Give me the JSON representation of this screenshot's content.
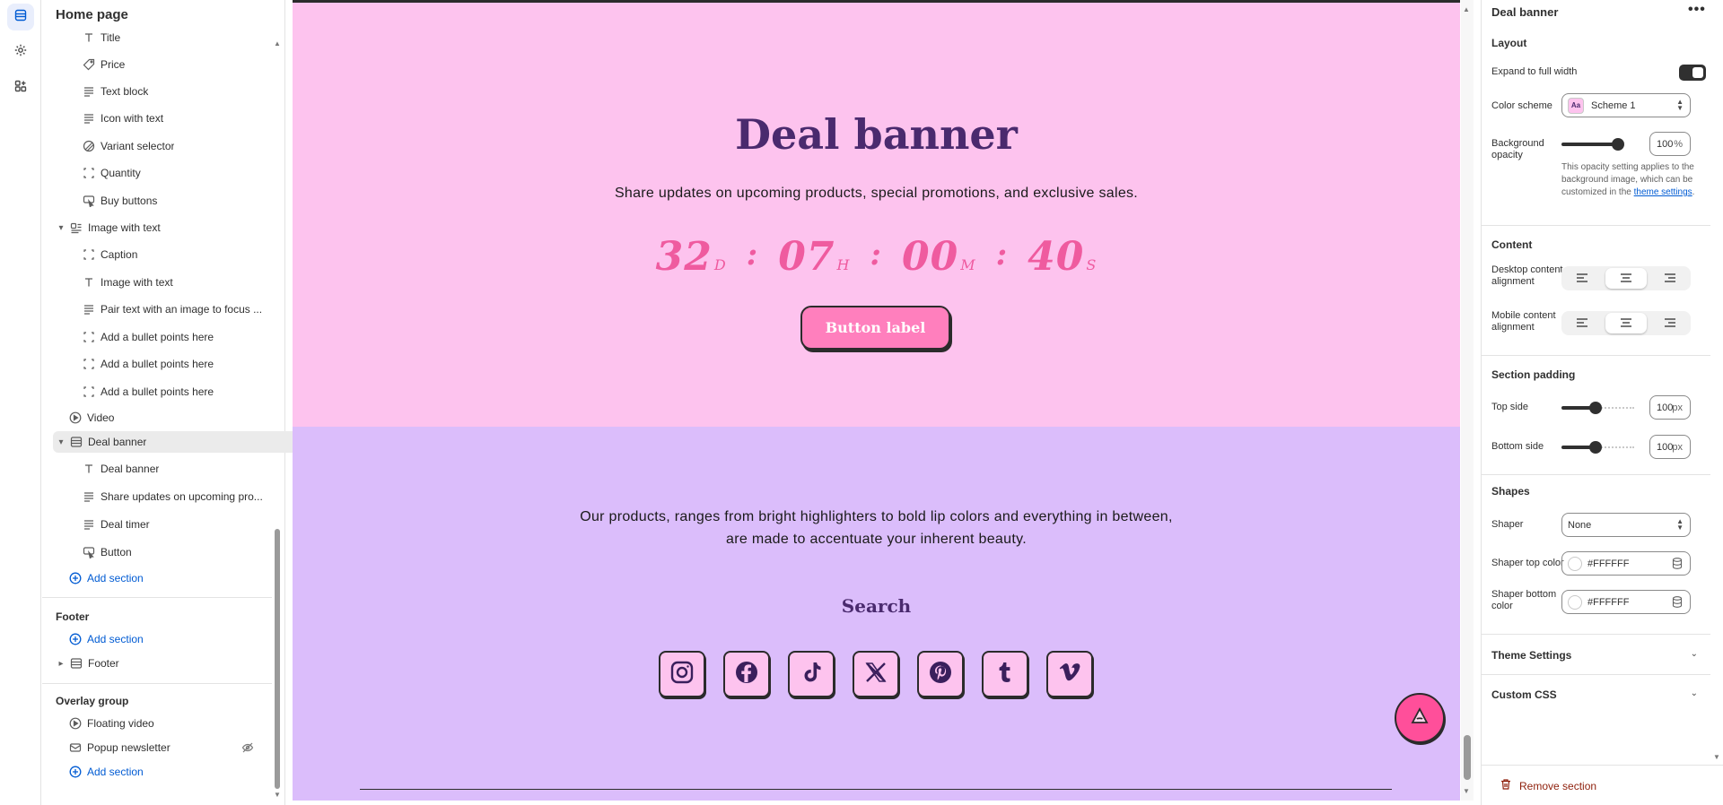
{
  "sidebar": {
    "title": "Home page",
    "items": [
      {
        "label": "Title",
        "icon": "text-icon"
      },
      {
        "label": "Price",
        "icon": "price-tag-icon"
      },
      {
        "label": "Text block",
        "icon": "text-lines-icon"
      },
      {
        "label": "Icon with text",
        "icon": "text-lines-icon"
      },
      {
        "label": "Variant selector",
        "icon": "variant-icon"
      },
      {
        "label": "Quantity",
        "icon": "block-icon"
      },
      {
        "label": "Buy buttons",
        "icon": "cursor-button-icon"
      },
      {
        "label": "Image with text",
        "icon": "image-text-icon"
      },
      {
        "label": "Caption",
        "icon": "block-icon"
      },
      {
        "label": "Image with text",
        "icon": "text-icon"
      },
      {
        "label": "Pair text with an image to focus ...",
        "icon": "text-lines-icon"
      },
      {
        "label": "Add a bullet points here",
        "icon": "block-icon"
      },
      {
        "label": "Add a bullet points here",
        "icon": "block-icon"
      },
      {
        "label": "Add a bullet points here",
        "icon": "block-icon"
      },
      {
        "label": "Video",
        "icon": "play-icon"
      },
      {
        "label": "Deal banner",
        "icon": "section-icon"
      },
      {
        "label": "Deal banner",
        "icon": "text-icon"
      },
      {
        "label": "Share updates on upcoming pro...",
        "icon": "text-lines-icon"
      },
      {
        "label": "Deal timer",
        "icon": "text-lines-icon"
      },
      {
        "label": "Button",
        "icon": "cursor-button-icon"
      }
    ],
    "add_section": "Add section",
    "footer_group": {
      "title": "Footer",
      "add_section": "Add section",
      "item": "Footer"
    },
    "overlay_group": {
      "title": "Overlay group",
      "items": [
        "Floating video",
        "Popup newsletter"
      ],
      "add_section": "Add section"
    }
  },
  "preview": {
    "deal": {
      "title": "Deal banner",
      "subtitle": "Share updates on upcoming products, special promotions, and exclusive sales.",
      "timer": [
        {
          "value": "32",
          "unit": "D"
        },
        {
          "value": "07",
          "unit": "H"
        },
        {
          "value": "00",
          "unit": "M"
        },
        {
          "value": "40",
          "unit": "S"
        }
      ],
      "separator": ":",
      "button": "Button label",
      "colors": {
        "background": "#fdc3ee",
        "title": "#4a2a6e",
        "timer": "#ef5b9f",
        "button": "#ff7fbd"
      }
    },
    "lower": {
      "text": "Our products, ranges from bright highlighters to bold lip colors and everything in between, are made to accentuate your inherent beauty.",
      "search_title": "Search",
      "social_icons": [
        "instagram-icon",
        "facebook-icon",
        "tiktok-icon",
        "x-icon",
        "pinterest-icon",
        "tumblr-icon",
        "vimeo-icon"
      ],
      "background": "#dbbdfb"
    }
  },
  "panel": {
    "title": "Deal banner",
    "more": "•••",
    "layout": {
      "heading": "Layout",
      "expand_label": "Expand to full width",
      "expand_on": true,
      "color_scheme_label": "Color scheme",
      "color_scheme_value": "Scheme 1",
      "swatch_text": "Aa",
      "bg_opacity_label": "Background opacity",
      "bg_opacity_value": "100",
      "bg_opacity_suffix": "%",
      "help_text": "This opacity setting applies to the background image, which can be customized in the",
      "help_link": "theme settings",
      "help_end": "."
    },
    "content": {
      "heading": "Content",
      "desktop_label": "Desktop content alignment",
      "mobile_label": "Mobile content alignment",
      "selected": "center"
    },
    "padding": {
      "heading": "Section padding",
      "top_label": "Top side",
      "top_value": "100",
      "bottom_label": "Bottom side",
      "bottom_value": "100",
      "suffix": "px"
    },
    "shapes": {
      "heading": "Shapes",
      "shaper_label": "Shaper",
      "shaper_value": "None",
      "top_color_label": "Shaper top color",
      "top_color_value": "#FFFFFF",
      "bottom_color_label": "Shaper bottom color",
      "bottom_color_value": "#FFFFFF"
    },
    "theme_settings": "Theme Settings",
    "custom_css": "Custom CSS",
    "remove_section": "Remove section"
  }
}
